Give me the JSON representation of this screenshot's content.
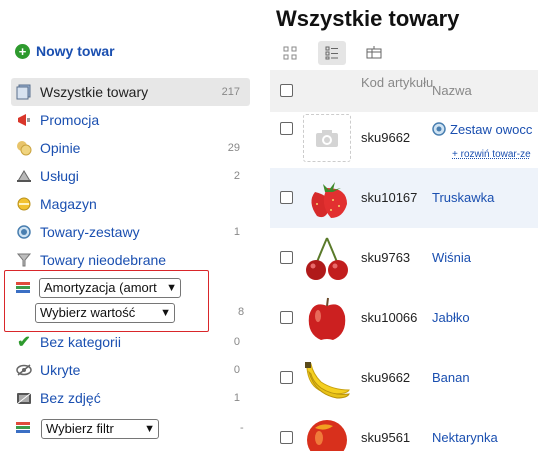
{
  "page_title": "Wszystkie towary",
  "new_item_label": "Nowy towar",
  "nav": [
    {
      "label": "Wszystkie towary",
      "count": "217"
    },
    {
      "label": "Promocja",
      "count": ""
    },
    {
      "label": "Opinie",
      "count": "29"
    },
    {
      "label": "Usługi",
      "count": "2"
    },
    {
      "label": "Magazyn",
      "count": ""
    },
    {
      "label": "Towary-zestawy",
      "count": "1"
    },
    {
      "label": "Towary nieodebrane",
      "count": ""
    }
  ],
  "filter": {
    "select1_value": "Amortyzacja (amort",
    "select2_value": "Wybierz wartość",
    "count": "8"
  },
  "nav2": [
    {
      "label": "Bez kategorii",
      "count": "0"
    },
    {
      "label": "Ukryte",
      "count": "0"
    },
    {
      "label": "Bez zdjęć",
      "count": "1"
    }
  ],
  "filter_select_value": "Wybierz filtr",
  "filter_select_count": "-",
  "table": {
    "col_sku": "Kod artykułu",
    "col_name": "Nazwa",
    "rows": [
      {
        "sku": "sku9662",
        "name": "Zestaw owocc",
        "sub": "+ rozwiń towar-ze"
      },
      {
        "sku": "sku10167",
        "name": "Truskawka"
      },
      {
        "sku": "sku9763",
        "name": "Wiśnia"
      },
      {
        "sku": "sku10066",
        "name": "Jabłko"
      },
      {
        "sku": "sku9662",
        "name": "Banan"
      },
      {
        "sku": "sku9561",
        "name": "Nektarynka"
      }
    ]
  },
  "colors": {
    "link": "#1a4fb0",
    "highlight_border": "#d9262a",
    "row_alt": "#eef3fa"
  }
}
